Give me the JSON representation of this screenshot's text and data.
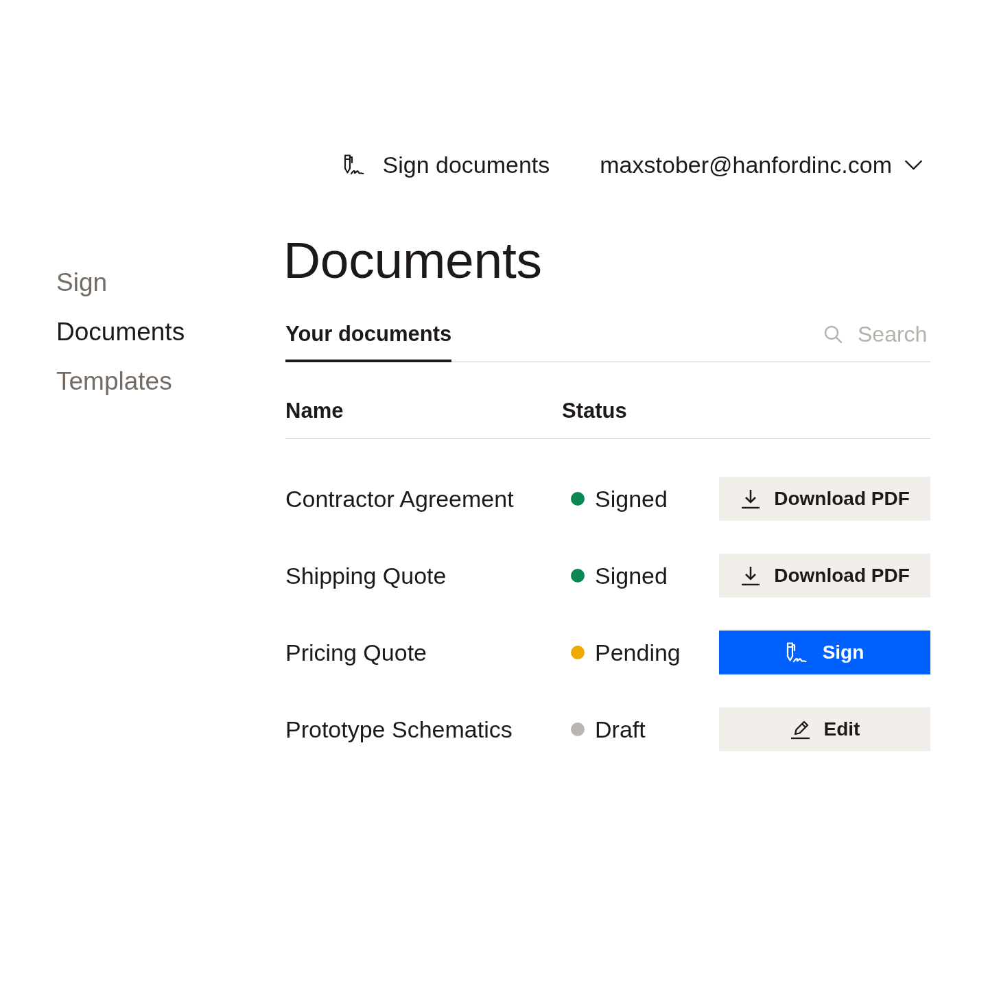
{
  "top_bar": {
    "sign_documents": "Sign documents",
    "account": "maxstober@hanfordinc.com"
  },
  "sidebar": {
    "items": [
      {
        "label": "Sign",
        "selected": false
      },
      {
        "label": "Documents",
        "selected": true
      },
      {
        "label": "Templates",
        "selected": false
      }
    ]
  },
  "page_title": "Documents",
  "tabs": [
    {
      "label": "Your documents",
      "selected": true
    }
  ],
  "search": {
    "placeholder": "Search"
  },
  "table": {
    "columns": [
      "Name",
      "Status"
    ],
    "rows": [
      {
        "name": "Contractor Agreement",
        "status": "Signed",
        "color": "#0a8754",
        "action": {
          "kind": "download",
          "label": "Download PDF"
        }
      },
      {
        "name": "Shipping Quote",
        "status": "Signed",
        "color": "#0a8754",
        "action": {
          "kind": "download",
          "label": "Download PDF"
        }
      },
      {
        "name": "Pricing Quote",
        "status": "Pending",
        "color": "#f0a900",
        "action": {
          "kind": "sign",
          "label": "Sign"
        }
      },
      {
        "name": "Prototype Schematics",
        "status": "Draft",
        "color": "#bbb6b0",
        "action": {
          "kind": "edit",
          "label": "Edit"
        }
      }
    ]
  }
}
